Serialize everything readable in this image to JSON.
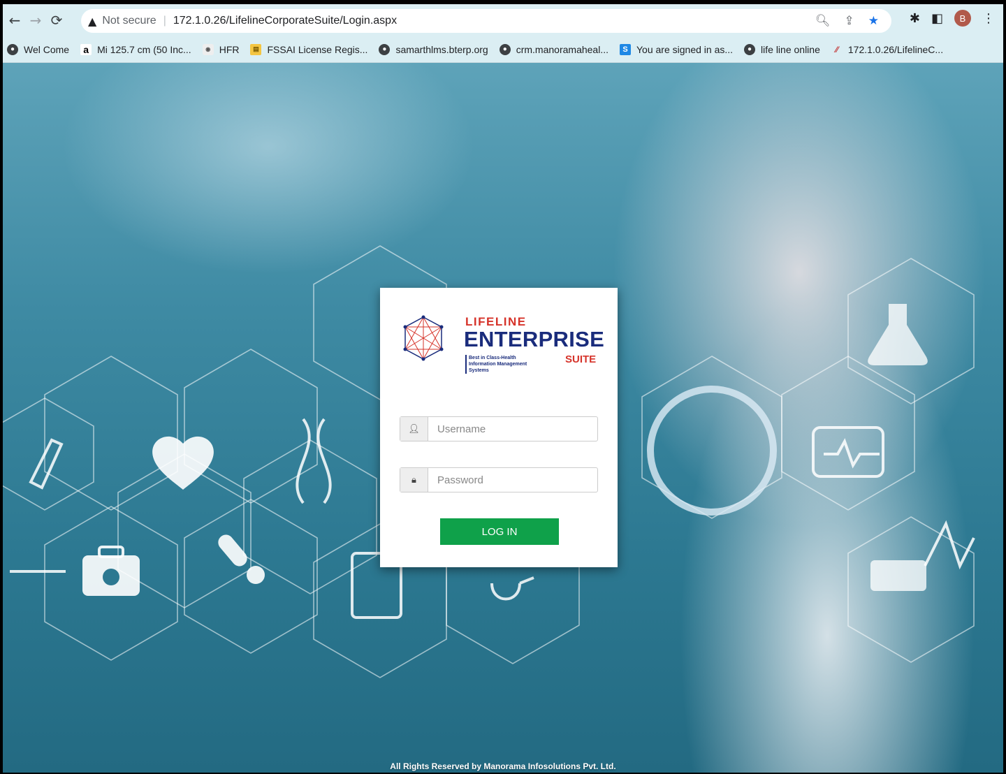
{
  "browser": {
    "security_label": "Not secure",
    "url": "172.1.0.26/LifelineCorporateSuite/Login.aspx",
    "profile_initial": "B"
  },
  "bookmarks": [
    {
      "label": "Wel Come",
      "icon": "globe-icon"
    },
    {
      "label": "Mi 125.7 cm (50 Inc...",
      "icon": "amazon-icon"
    },
    {
      "label": "HFR",
      "icon": "hfr-icon"
    },
    {
      "label": "FSSAI License Regis...",
      "icon": "fssai-icon"
    },
    {
      "label": "samarthlms.bterp.org",
      "icon": "globe-icon"
    },
    {
      "label": "crm.manoramaheal...",
      "icon": "globe-icon"
    },
    {
      "label": "You are signed in as...",
      "icon": "s-icon"
    },
    {
      "label": "life line online",
      "icon": "globe-icon"
    },
    {
      "label": "172.1.0.26/LifelineC...",
      "icon": "lifeline-icon"
    }
  ],
  "login": {
    "brand_line1": "LIFELINE",
    "brand_line2": "ENTERPRISE",
    "brand_tagline": "Best in Class-Health Information Management Systems",
    "brand_suite": "SUITE",
    "username_placeholder": "Username",
    "password_placeholder": "Password",
    "login_label": "LOG IN"
  },
  "footer": {
    "text": "All Rights Reserved by Manorama Infosolutions Pvt. Ltd."
  },
  "colors": {
    "toolbar_bg": "#dbeef3",
    "brand_red": "#d6332a",
    "brand_blue": "#1a2c7c",
    "login_green": "#0fa14a"
  }
}
